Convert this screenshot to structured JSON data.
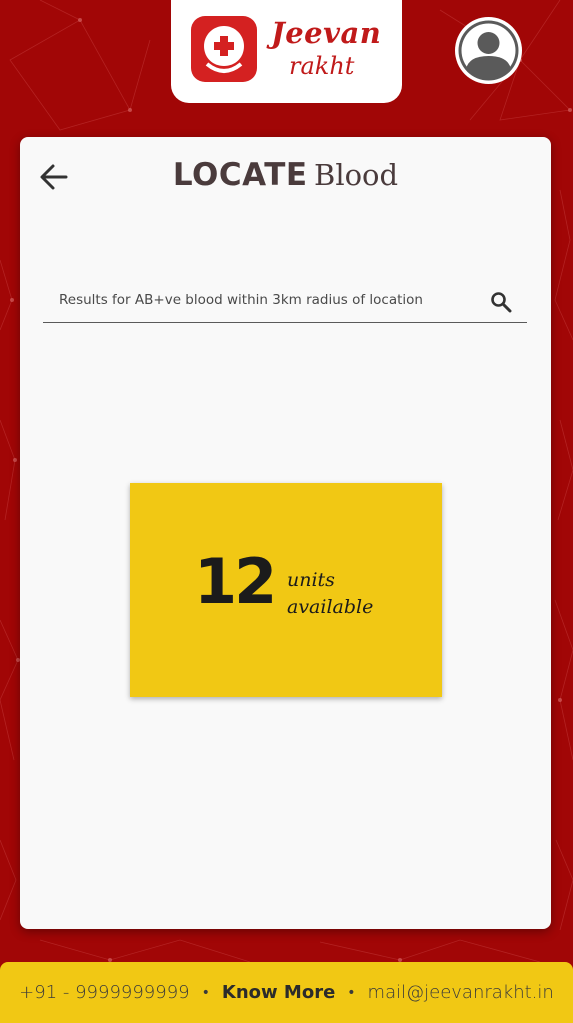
{
  "brand": {
    "name_line1": "Jeevan",
    "name_line2": "rakht",
    "color": "#c01a1a"
  },
  "header": {
    "avatar_icon": "user-avatar-icon"
  },
  "page": {
    "title_strong": "LOCATE",
    "title_light": "Blood",
    "back_icon": "arrow-left-icon"
  },
  "search": {
    "value": "Results for AB+ve blood within 3km radius of location",
    "icon": "search-icon"
  },
  "result": {
    "count": "12",
    "label_line1": "units",
    "label_line2": "available",
    "color": "#f1c814"
  },
  "footer": {
    "phone": "+91 - 9999999999",
    "know_more": "Know More",
    "email": "mail@jeevanrakht.in",
    "separator": "•"
  },
  "colors": {
    "background": "#a10606",
    "card": "#f9f9f9",
    "accent": "#f1c814",
    "text_dark": "#4a3b3c"
  }
}
